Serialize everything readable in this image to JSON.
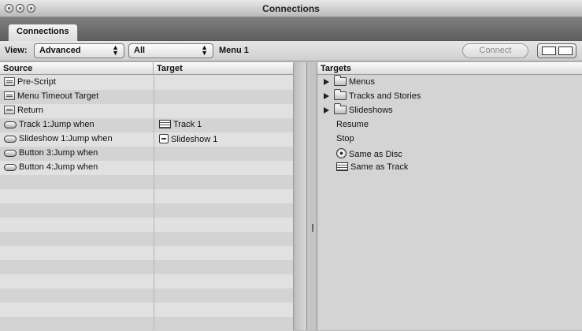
{
  "window": {
    "title": "Connections"
  },
  "tabs": [
    {
      "label": "Connections"
    }
  ],
  "toolbar": {
    "view_label": "View:",
    "view_value": "Advanced",
    "filter_value": "All",
    "current_menu": "Menu 1",
    "connect_label": "Connect"
  },
  "left": {
    "source_header": "Source",
    "target_header": "Target",
    "rows": [
      {
        "source": "Pre-Script",
        "source_icon": "script-icon",
        "target": "",
        "target_icon": ""
      },
      {
        "source": "Menu Timeout Target",
        "source_icon": "script-icon",
        "target": "",
        "target_icon": ""
      },
      {
        "source": "Return",
        "source_icon": "script-icon",
        "target": "",
        "target_icon": ""
      },
      {
        "source": "Track 1:Jump when",
        "source_icon": "button-icon",
        "target": "Track 1",
        "target_icon": "track-icon"
      },
      {
        "source": "Slideshow 1:Jump when",
        "source_icon": "button-icon",
        "target": "Slideshow 1",
        "target_icon": "slideshow-icon"
      },
      {
        "source": "Button 3:Jump when",
        "source_icon": "button-icon",
        "target": "",
        "target_icon": ""
      },
      {
        "source": "Button 4:Jump when",
        "source_icon": "button-icon",
        "target": "",
        "target_icon": ""
      }
    ]
  },
  "right": {
    "header": "Targets",
    "items": [
      {
        "label": "Menus",
        "icon": "folder-icon",
        "expandable": true
      },
      {
        "label": "Tracks and Stories",
        "icon": "folder-icon",
        "expandable": true
      },
      {
        "label": "Slideshows",
        "icon": "folder-icon",
        "expandable": true
      },
      {
        "label": "Resume",
        "icon": "",
        "expandable": false
      },
      {
        "label": "Stop",
        "icon": "",
        "expandable": false
      },
      {
        "label": "Same as Disc",
        "icon": "disc-icon",
        "expandable": false
      },
      {
        "label": "Same as Track",
        "icon": "track-icon",
        "expandable": false
      }
    ]
  }
}
